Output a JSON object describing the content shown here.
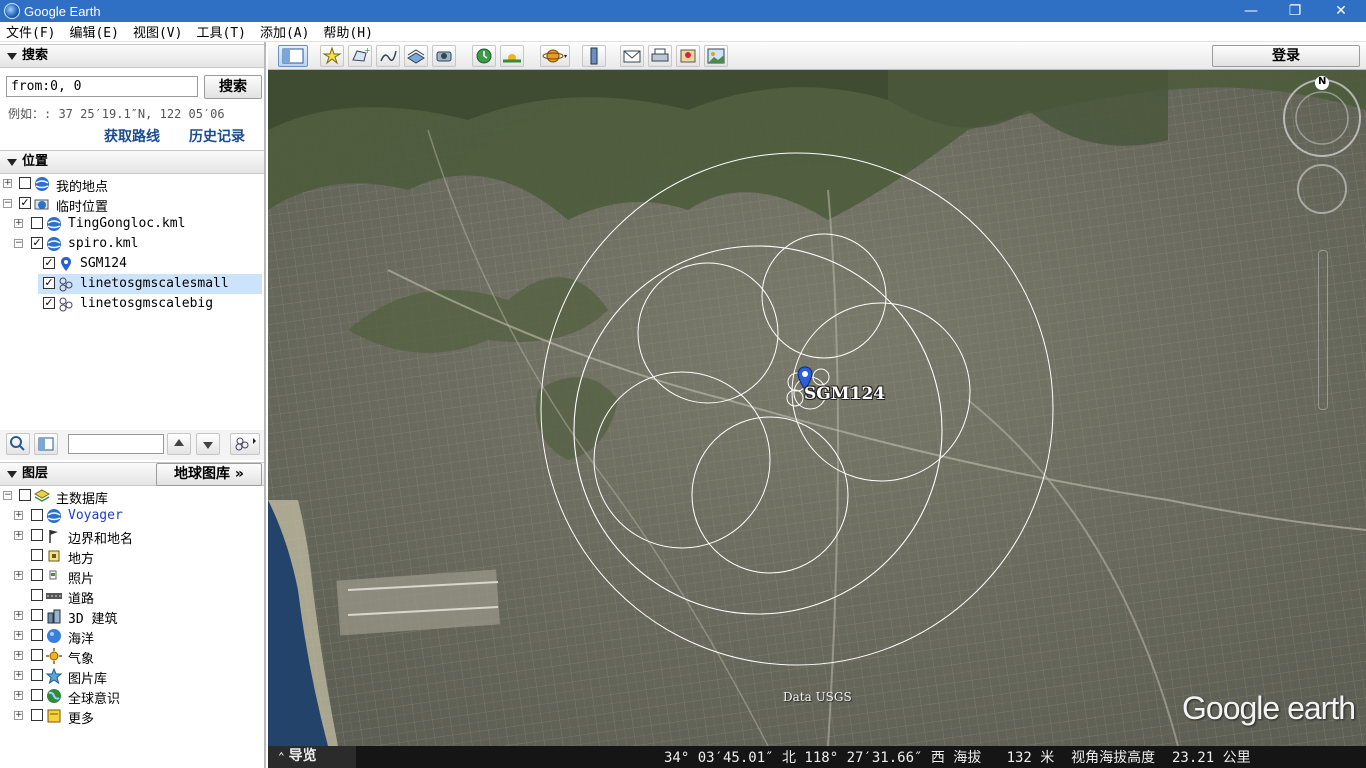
{
  "window": {
    "title": "Google Earth",
    "minimize": "—",
    "maximize": "❐",
    "close": "✕"
  },
  "menu": [
    "文件(F)",
    "编辑(E)",
    "视图(V)",
    "工具(T)",
    "添加(A)",
    "帮助(H)"
  ],
  "search": {
    "header": "搜索",
    "input_value": "from:0, 0",
    "button": "搜索",
    "hint": "例如：: 37 25′19.1″N, 122 05′06",
    "link_directions": "获取路线",
    "link_history": "历史记录"
  },
  "places": {
    "header": "位置",
    "items": [
      {
        "label": "我的地点",
        "checked": false
      },
      {
        "label": "临时位置",
        "checked": true
      },
      {
        "label": "TingGongloc.kml",
        "checked": false
      },
      {
        "label": "spiro.kml",
        "checked": true
      },
      {
        "label": "SGM124",
        "checked": true
      },
      {
        "label": "linetosgmscalesmall",
        "checked": true
      },
      {
        "label": "linetosgmscalebig",
        "checked": true
      }
    ]
  },
  "layers": {
    "header": "图层",
    "gallery_button": "地球图库 »",
    "items": [
      {
        "label": "主数据库"
      },
      {
        "label": "Voyager"
      },
      {
        "label": "边界和地名"
      },
      {
        "label": "地方"
      },
      {
        "label": "照片"
      },
      {
        "label": "道路"
      },
      {
        "label": "3D 建筑"
      },
      {
        "label": "海洋"
      },
      {
        "label": "气象"
      },
      {
        "label": "图片库"
      },
      {
        "label": "全球意识"
      },
      {
        "label": "更多"
      }
    ]
  },
  "toolbar": {
    "login": "登录"
  },
  "map": {
    "placemark_label": "SGM124",
    "attribution": "Data USGS",
    "logo": "Google earth",
    "compass_north": "N"
  },
  "status": {
    "overview": "导览",
    "coords": "34° 03′45.01″ 北 118° 27′31.66″ 西 海拔   132 米  视角海拔高度  23.21 公里"
  },
  "colors": {
    "titlebar": "#2f6fc4",
    "selection": "#cce4fb",
    "link": "#1c4c8f",
    "circle": "#ffffff"
  }
}
